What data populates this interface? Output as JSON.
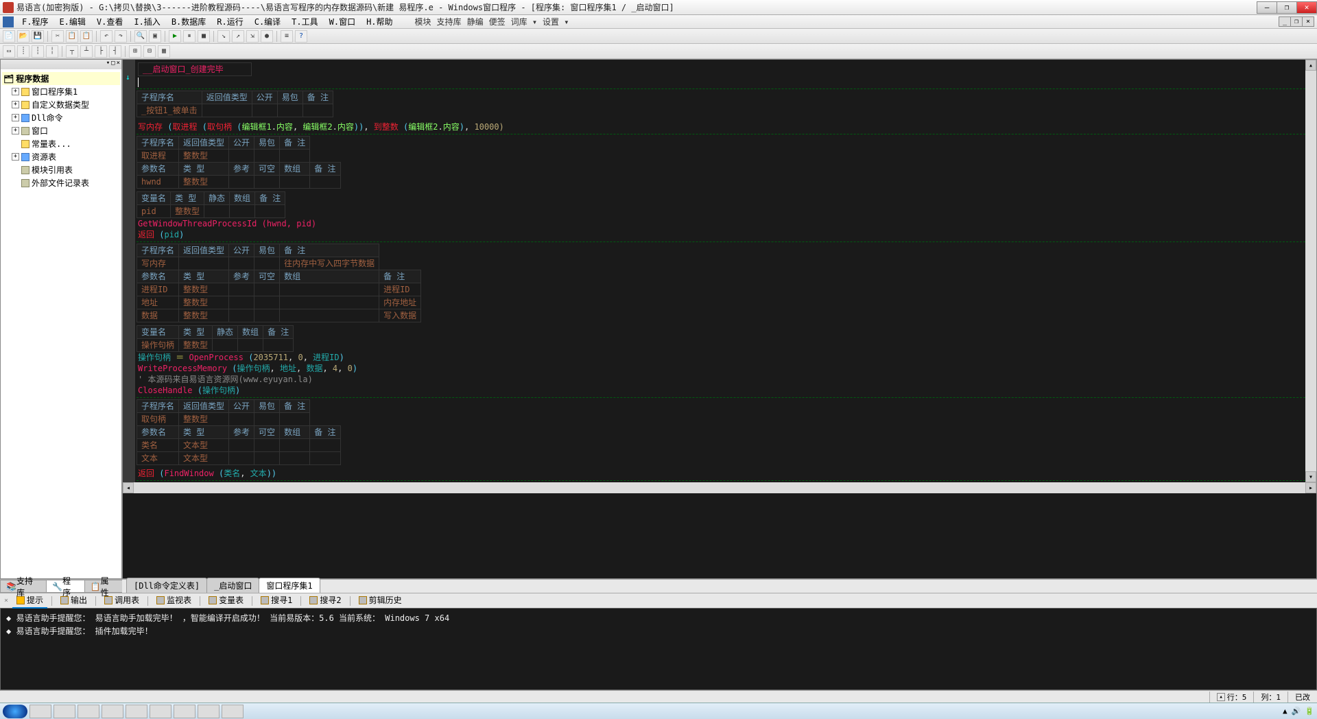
{
  "title": "易语言(加密狗版) - G:\\拷贝\\替换\\3------进阶教程源码----\\易语言写程序的内存数据源码\\新建 易程序.e - Windows窗口程序 - [程序集: 窗口程序集1 / _启动窗口]",
  "menus": [
    "F.程序",
    "E.编辑",
    "V.查看",
    "I.插入",
    "B.数据库",
    "R.运行",
    "C.编译",
    "T.工具",
    "W.窗口",
    "H.帮助"
  ],
  "tb2": [
    "模块",
    "支持库",
    "静编",
    "便签",
    "词库 ▾",
    "设置 ▾"
  ],
  "tree_title": "程序数据",
  "tree": [
    {
      "label": "窗口程序集1"
    },
    {
      "label": "自定义数据类型"
    },
    {
      "label": "Dll命令"
    },
    {
      "label": "窗口"
    },
    {
      "label": "常量表..."
    },
    {
      "label": "资源表"
    },
    {
      "label": "模块引用表"
    },
    {
      "label": "外部文件记录表"
    }
  ],
  "lefttabs": [
    "支持库",
    "程序",
    "属性"
  ],
  "doctabs": [
    "[Dll命令定义表]",
    "_启动窗口",
    "窗口程序集1"
  ],
  "hdr": {
    "sub": "子程序名",
    "ret": "返回值类型",
    "pub": "公开",
    "pkg": "易包",
    "note": "备 注",
    "param": "参数名",
    "type": "类 型",
    "ref": "参考",
    "opt": "可空",
    "arr": "数组",
    "var": "变量名",
    "stat": "静态"
  },
  "code": {
    "line0": "__启动窗口_创建完毕",
    "btn": "_按钮1_被单击",
    "wm": "写内存",
    "getproc": "取进程",
    "hwnd": "hwnd",
    "pid": "pid",
    "inttype": "整数型",
    "wl": "写内存 (取进程 (取句柄 (编辑框1.内容, 编辑框2.内容)), 到整数 (编辑框2.内容),",
    "wl2": "10000)",
    "gw": "GetWindowThreadProcessId (hwnd, pid)",
    "ret": "返回 (pid)",
    "wm2_note": "往内存中写入四字节数据",
    "procid": "进程ID",
    "addr": "地址",
    "dat": "数据",
    "procid_n": "进程ID",
    "addr_n": "内存地址",
    "dat_n": "写入数据",
    "ophnd": "操作句柄",
    "l1": "操作句柄 ＝ OpenProcess (2035711, 0, 进程ID)",
    "l2": "WriteProcessMemory (操作句柄, 地址, 数据, 4, 0)",
    "l3": "' 本源码来自易语言资源网(www.eyuyan.la)",
    "l4": "CloseHandle (操作句柄)",
    "gethnd": "取句柄",
    "txttype": "文本型",
    "cls": "类名",
    "txt": "文本",
    "fw": "返回 (FindWindow (类名, 文本))"
  },
  "bottabs": [
    "提示",
    "输出",
    "调用表",
    "监视表",
    "变量表",
    "搜寻1",
    "搜寻2",
    "剪辑历史"
  ],
  "output": [
    "易语言助手提醒您： 易语言助手加载完毕！ ，智能编译开启成功！ 当前易版本：5.6  当前系统： Windows 7 x64",
    "易语言助手提醒您： 插件加载完毕！"
  ],
  "status": {
    "row": "行：5",
    "col": "列：1",
    "mod": "已改"
  }
}
